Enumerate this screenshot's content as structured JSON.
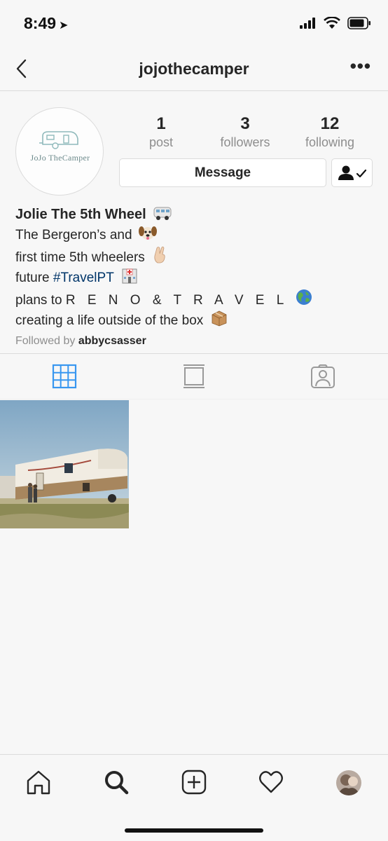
{
  "status_bar": {
    "time": "8:49"
  },
  "header": {
    "username": "jojothecamper"
  },
  "profile": {
    "avatar_text": "JoJo TheCamper",
    "stats": [
      {
        "value": "1",
        "label": "post"
      },
      {
        "value": "3",
        "label": "followers"
      },
      {
        "value": "12",
        "label": "following"
      }
    ],
    "message_label": "Message"
  },
  "bio": {
    "name": "Jolie The 5th Wheel",
    "line1": "The Bergeron’s and",
    "line2": "first time 5th wheelers",
    "line3_prefix": "future",
    "line3_hashtag": "#TravelPT",
    "line4_prefix": "plans to",
    "line4_spaced": "R E N O & T R A V E L",
    "line5": "creating a life outside of the box",
    "followed_by_prefix": "Followed by",
    "followed_by_user": "abbycsasser"
  },
  "colors": {
    "accent_blue": "#3897f0",
    "hashtag": "#003569",
    "muted": "#8e8e8e"
  },
  "icons": [
    "back-icon",
    "more-icon",
    "grid-icon",
    "feed-icon",
    "tagged-icon",
    "home-icon",
    "search-icon",
    "add-icon",
    "heart-icon",
    "profile-icon"
  ]
}
